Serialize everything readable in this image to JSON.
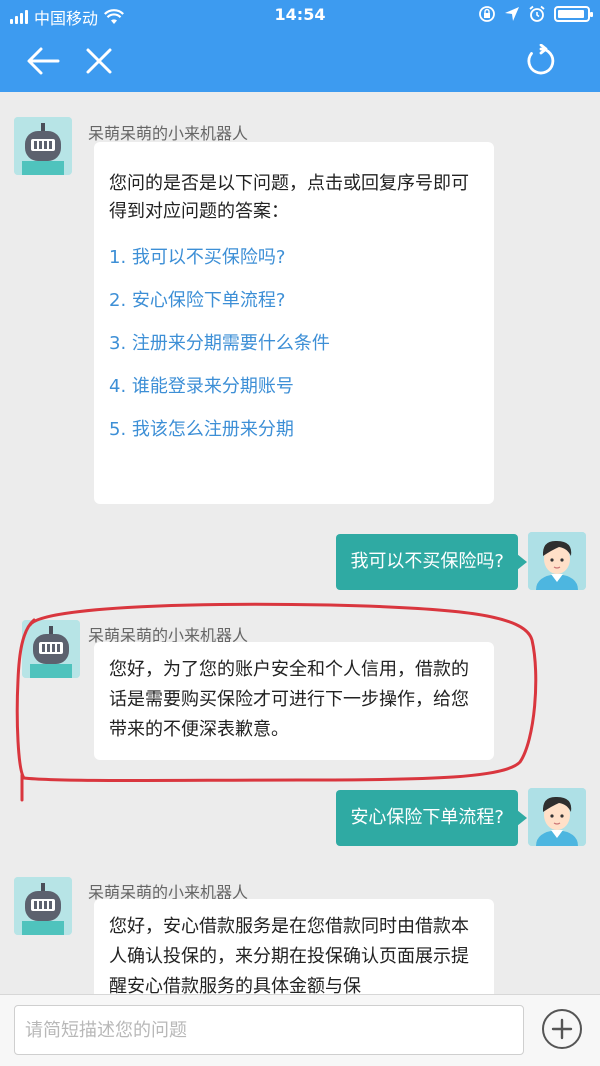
{
  "status_bar": {
    "carrier": "中国移动",
    "time": "14:54"
  },
  "navbar": {
    "back_icon": "arrow-left-icon",
    "close_icon": "close-icon",
    "refresh_icon": "refresh-icon"
  },
  "bot_name": "呆萌呆萌的小来机器人",
  "messages": [
    {
      "from": "bot",
      "text": "您问的是否是以下问题，点击或回复序号即可得到对应问题的答案：",
      "options": [
        "1. 我可以不买保险吗?",
        "2. 安心保险下单流程?",
        "3. 注册来分期需要什么条件",
        "4. 谁能登录来分期账号",
        "5. 我该怎么注册来分期"
      ]
    },
    {
      "from": "user",
      "text": "我可以不买保险吗?"
    },
    {
      "from": "bot",
      "text": "您好，为了您的账户安全和个人信用，借款的话是需要购买保险才可进行下一步操作，给您带来的不便深表歉意。"
    },
    {
      "from": "user",
      "text": "安心保险下单流程?"
    },
    {
      "from": "bot",
      "text": "您好，安心借款服务是在您借款同时由借款本人确认投保的，来分期在投保确认页面展示提醒安心借款服务的具体金额与保"
    }
  ],
  "input_bar": {
    "placeholder": "请简短描述您的问题",
    "value": ""
  },
  "colors": {
    "header": "#3d9bf0",
    "user_bubble": "#2faaa3",
    "link": "#3d8fd6",
    "annotation": "#d9363e"
  }
}
